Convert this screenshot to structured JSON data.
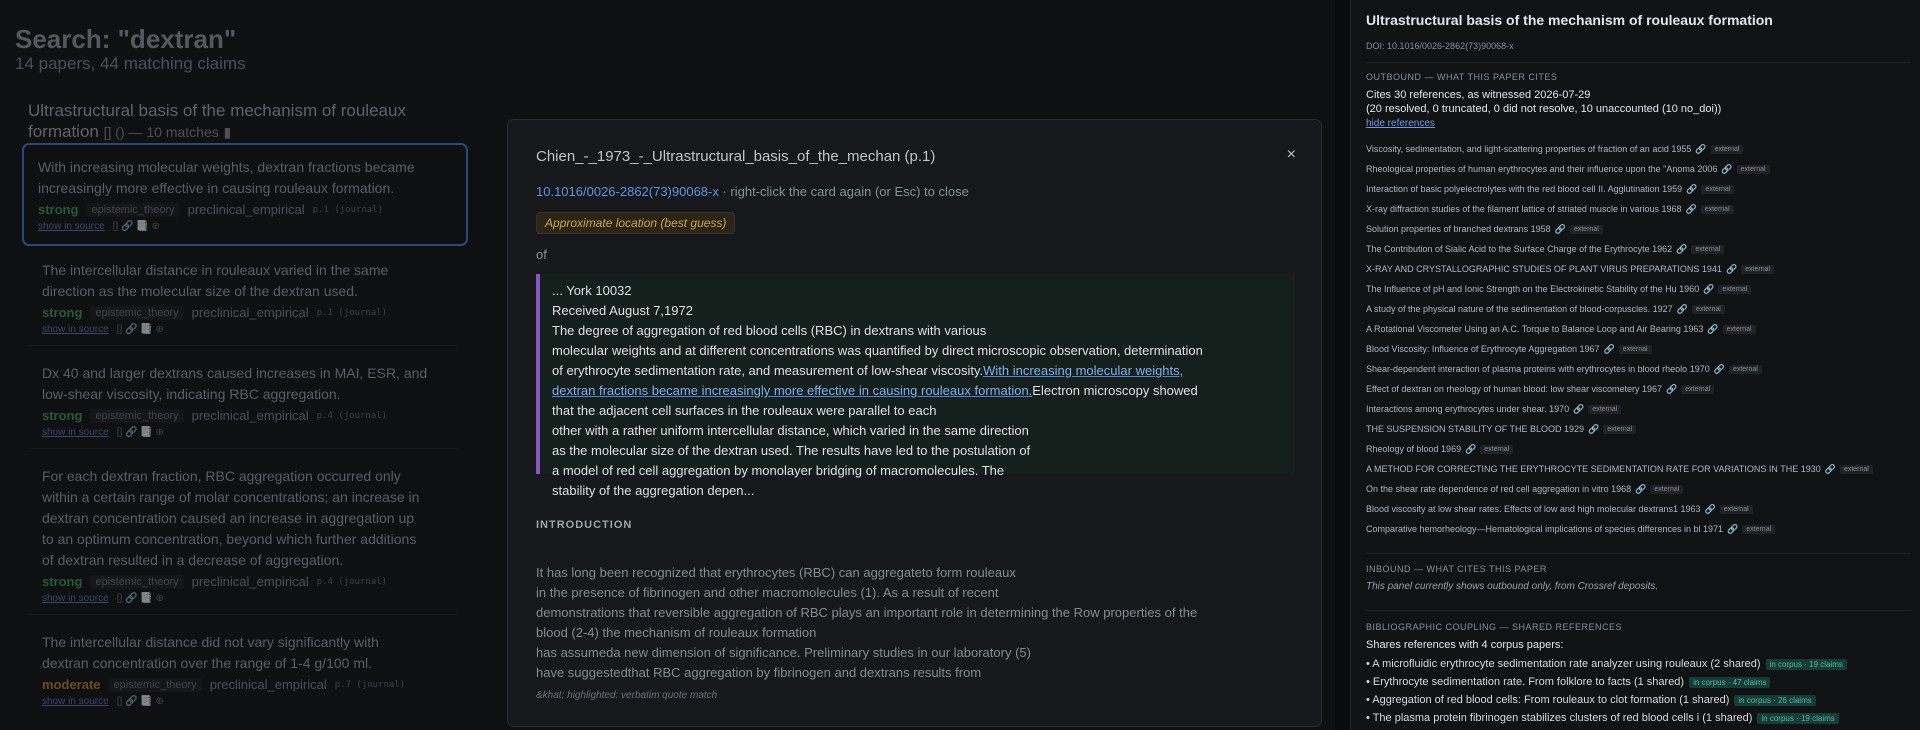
{
  "search": {
    "title": "Search: \"dextran\"",
    "subtitle": "14 papers, 44 matching claims"
  },
  "paper": {
    "title": "Ultrastructural basis of the mechanism of rouleaux formation",
    "meta": "[] () — 10 matches",
    "meta_icon": "chart-icon"
  },
  "claims": [
    {
      "text_lines": [
        "With increasing molecular weights, dextran fractions became",
        "increasingly more effective in causing rouleaux formation."
      ],
      "strength": "strong",
      "tag1": "epistemic_theory",
      "tag2": "preclinical_empirical",
      "page": "p.1 (journal)",
      "source": "show in source",
      "icons": "[] 🔗 📑 ⊕"
    },
    {
      "text_lines": [
        "The intercellular distance in rouleaux varied in the same",
        "direction as the molecular size of the dextran used."
      ],
      "strength": "strong",
      "tag1": "epistemic_theory",
      "tag2": "preclinical_empirical",
      "page": "p.1 (journal)",
      "source": "show in source",
      "icons": "[] 🔗 📑 ⊕"
    },
    {
      "text_lines": [
        "Dx 40 and larger dextrans caused increases in MAI, ESR, and",
        "low-shear viscosity, indicating RBC aggregation."
      ],
      "strength": "strong",
      "tag1": "epistemic_theory",
      "tag2": "preclinical_empirical",
      "page": "p.4 (journal)",
      "source": "show in source",
      "icons": "[] 🔗 📑 ⊕"
    },
    {
      "text_lines": [
        "For each dextran fraction, RBC aggregation occurred only",
        "within a certain range of molar concentrations; an increase in",
        "dextran concentration caused an increase in aggregation up",
        "to an optimum concentration, beyond which further additions",
        "of dextran resulted in a decrease of aggregation."
      ],
      "strength": "strong",
      "tag1": "epistemic_theory",
      "tag2": "preclinical_empirical",
      "page": "p.4 (journal)",
      "source": "show in source",
      "icons": "[] 🔗 📑 ⊕"
    },
    {
      "text_lines": [
        "The intercellular distance did not vary significantly with",
        "dextran concentration over the range of 1-4 g/100 ml."
      ],
      "strength": "moderate",
      "tag1": "epistemic_theory",
      "tag2": "preclinical_empirical",
      "page": "p.7 (journal)",
      "source": "show in source",
      "icons": "[] 🔗 📑 ⊕"
    }
  ],
  "modal": {
    "title": "Chien_-_1973_-_Ultrastructural_basis_of_the_mechan (p.1)",
    "close": "×",
    "doi": "10.1016/0026-2862(73)90068-x",
    "hint": " · right-click the card again (or Esc) to close",
    "approx": "Approximate location (best guess)",
    "of": "of",
    "excerpt": {
      "l1": "... York 10032",
      "l2": "Received August 7,1972",
      "l3": "The degree of aggregation of red blood cells (RBC) in dextrans with various",
      "l4": "molecular weights and at different concentrations was quantified by direct microscopic observation, determination",
      "l5a": "of erythrocyte sedimentation rate, and measurement of low-shear viscosity.",
      "l5b": "With increasing molecular weights,",
      "l6a": "dextran fractions became increasingly more effective in causing rouleaux formation.",
      "l6b": "Electron microscopy showed",
      "l7": "that the adjacent cell surfaces in the rouleaux were parallel to each",
      "l8": "other with a rather uniform intercellular distance, which varied in the same direction",
      "l9": "as the molecular size of the dextran used. The results have led to the postulation of",
      "l10": "a model of red cell aggregation by monolayer bridging of macromolecules. The",
      "l11": "stability of the aggregation depen..."
    },
    "section": "INTRODUCTION",
    "body": [
      "It has long been recognized that erythrocytes (RBC) can aggregateto form rouleaux",
      "in the presence of fibrinogen and other macromolecules (1). As a result of recent",
      "demonstrations that reversible aggregation of RBC plays an important role in determining the Row properties of the",
      "blood (2-4) the mechanism of rouleaux formation",
      "has assumeda new dimension of significance. Preliminary studies in our laboratory (5)",
      "have suggestedthat RBC aggregation by fibrinogen and dextrans results from"
    ],
    "footnote": "&khat; highlighted: verbatim quote match"
  },
  "panel": {
    "title": "Ultrastructural basis of the mechanism of rouleaux formation",
    "doi": "DOI: 10.1016/0026-2862(73)90068-x",
    "outbound_head": "OUTBOUND — WHAT THIS PAPER CITES",
    "outbound_line1": "Cites 30 references, as witnessed 2026-07-29",
    "outbound_line2": "(20 resolved, 0 truncated, 0 did not resolve, 10 unaccounted (10 no_doi))",
    "hide_refs": "hide references",
    "ext_label": "external",
    "references": [
      "Viscosity, sedimentation, and light-scattering properties of fraction of an acid 1955",
      "Rheological properties of human erythrocytes and their influence upon the \"Anoma 2006",
      "Interaction of basic polyelectrolytes with the red blood cell II. Agglutination 1959",
      "X-ray diffraction studies of the filament lattice of striated muscle in various 1968",
      "Solution properties of branched dextrans 1958",
      "The Contribution of Sialic Acid to the Surface Charge of the Erythrocyte 1962",
      "X-RAY AND CRYSTALLOGRAPHIC STUDIES OF PLANT VIRUS PREPARATIONS 1941",
      "The Influence of pH and Ionic Strength on the Electrokinetic Stability of the Hu 1960",
      "A study of the physical nature of the sedimentation of blood-corpuscles. 1927",
      "A Rotational Viscometer Using an A.C. Torque to Balance Loop and Air Bearing 1963",
      "Blood Viscosity: Influence of Erythrocyte Aggregation 1967",
      "Shear-dependent interaction of plasma proteins with erythrocytes in blood rheolo 1970",
      "Effect of dextran on rheology of human blood: low shear viscometery 1967",
      "Interactions among erythrocytes under shear. 1970",
      "THE SUSPENSION STABILITY OF THE BLOOD 1929",
      "Rheology of blood 1969",
      "A METHOD FOR CORRECTING THE ERYTHROCYTE SEDIMENTATION RATE FOR VARIATIONS IN THE 1930",
      "On the shear rate dependence of red cell aggregation in vitro 1968",
      "Blood viscosity at low shear rates. Effects of low and high molecular dextrans1 1963",
      "Comparative hemorheology—Hematological implications of species differences in bl 1971"
    ],
    "inbound_head": "INBOUND — WHAT CITES THIS PAPER",
    "inbound_text": "This panel currently shows outbound only, from Crossref deposits.",
    "coupling_head": "BIBLIOGRAPHIC COUPLING — SHARED REFERENCES",
    "coupling_line": "Shares references with 4 corpus papers:",
    "shared": [
      {
        "text": "• A microfluidic erythrocyte sedimentation rate analyzer using rouleaux (2 shared)",
        "badge": "in corpus · 19 claims"
      },
      {
        "text": "• Erythrocyte sedimentation rate. From folklore to facts (1 shared)",
        "badge": "in corpus · 47 claims"
      },
      {
        "text": "• Aggregation of red blood cells: From rouleaux to clot formation (1 shared)",
        "badge": "in corpus · 26 claims"
      },
      {
        "text": "• The plasma protein fibrinogen stabilizes clusters of red blood cells i (1 shared)",
        "badge": "in corpus · 19 claims"
      }
    ]
  }
}
